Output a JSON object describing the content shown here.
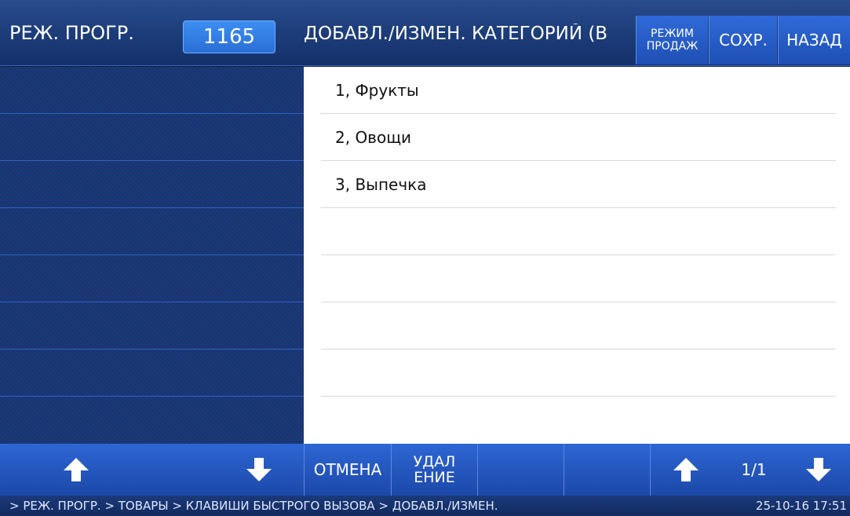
{
  "header": {
    "mode_label": "РЕЖ. ПРОГР.",
    "code": "1165",
    "title": "ДОБАВЛ./ИЗМЕН. КАТЕГОРИЙ (В",
    "sale_mode_line1": "РЕЖИМ",
    "sale_mode_line2": "ПРОДАЖ",
    "save_label": "СОХР.",
    "back_label": "НАЗАД"
  },
  "list": {
    "items": [
      {
        "label": "1, Фрукты"
      },
      {
        "label": "2, Овощи"
      },
      {
        "label": "3, Выпечка"
      },
      {
        "label": ""
      },
      {
        "label": ""
      },
      {
        "label": ""
      },
      {
        "label": ""
      },
      {
        "label": ""
      }
    ]
  },
  "toolbar": {
    "cancel_label": "ОТМЕНА",
    "delete_line1": "УДАЛ",
    "delete_line2": "ЕНИЕ",
    "page_indicator": "1/1",
    "icons": [
      "arrow-up-icon",
      "arrow-down-icon"
    ]
  },
  "status": {
    "breadcrumb": "> РЕЖ. ПРОГР. > ТОВАРЫ > КЛАВИШИ БЫСТРОГО ВЫЗОВА > ДОБАВЛ./ИЗМЕН.",
    "datetime": "25-10-16  17:51"
  },
  "colors": {
    "accent": "#2a6fd6",
    "header_bg": "#1d3d7a",
    "panel_bg": "#1c3a78",
    "toolbar_bg": "#2d66d4"
  }
}
